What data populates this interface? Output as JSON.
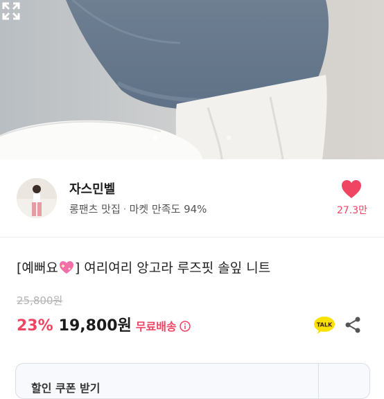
{
  "shop": {
    "name": "자스민벨",
    "tagline": "롱팬츠 맛집",
    "separator": "·",
    "rating": "마켓 만족도 94%",
    "likes": "27.3만"
  },
  "product": {
    "title_prefix": "[예뻐요",
    "title_suffix": "] 여리여리 앙고라 루즈핏 솔잎 니트",
    "original_price": "25,800원",
    "discount": "23%",
    "price": "19,800원",
    "shipping": "무료배송"
  },
  "actions": {
    "talk_label": "TALK"
  },
  "coupon": {
    "label": "할인 쿠폰 받기"
  },
  "colors": {
    "accent": "#ef4462",
    "talk_yellow": "#fae100"
  },
  "icons": {
    "expand": "expand-icon",
    "heart": "heart-icon",
    "info": "info-icon",
    "talk": "kakaotalk-icon",
    "share": "share-icon"
  }
}
